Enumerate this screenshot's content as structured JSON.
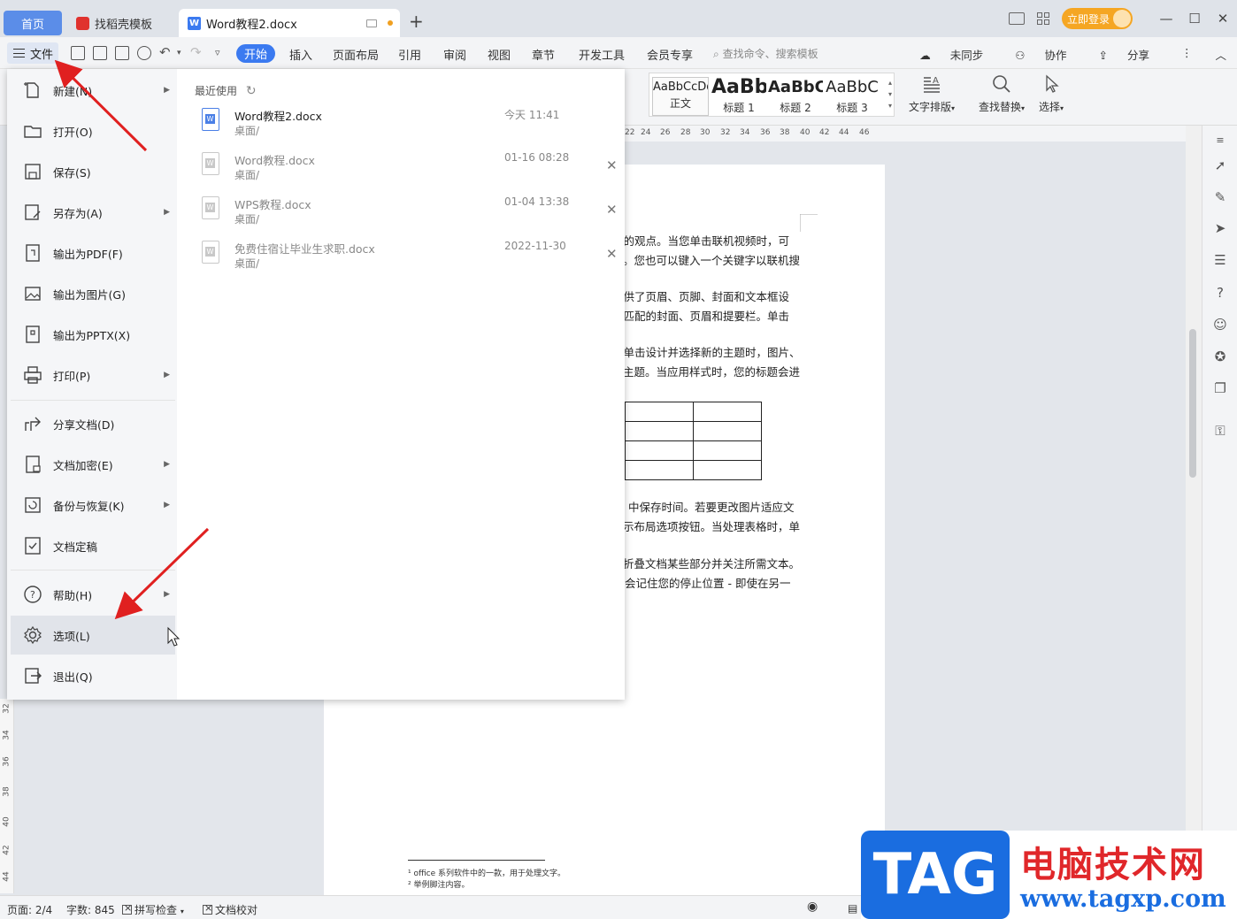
{
  "tabs": {
    "home": "首页",
    "template": "找稻壳模板",
    "document": "Word教程2.docx"
  },
  "window": {
    "login": "立即登录"
  },
  "toolbar": {
    "file": "文件",
    "start": "开始",
    "menus": [
      "插入",
      "页面布局",
      "引用",
      "审阅",
      "视图",
      "章节",
      "开发工具",
      "会员专享"
    ],
    "search_placeholder": "查找命令、搜索模板",
    "unsynced": "未同步",
    "collaborate": "协作",
    "share": "分享"
  },
  "ribbon": {
    "styles": [
      {
        "sample": "AaBbCcDd",
        "name": "正文"
      },
      {
        "sample": "AaBb",
        "name": "标题 1"
      },
      {
        "sample": "AaBbC",
        "name": "标题 2"
      },
      {
        "sample": "AaBbC",
        "name": "标题 3"
      }
    ],
    "text_layout": "文字排版",
    "find_replace": "查找替换",
    "select": "选择"
  },
  "ruler": [
    "22",
    "24",
    "26",
    "28",
    "30",
    "32",
    "34",
    "36",
    "38",
    "40",
    "42",
    "44",
    "46"
  ],
  "vruler": [
    "32",
    "34",
    "36",
    "38",
    "40",
    "42",
    "44"
  ],
  "file_menu": {
    "items": [
      {
        "label": "新建(N)",
        "icon": "new-file-icon",
        "arrow": true
      },
      {
        "label": "打开(O)",
        "icon": "folder-open-icon",
        "arrow": false
      },
      {
        "label": "保存(S)",
        "icon": "save-icon",
        "arrow": false
      },
      {
        "label": "另存为(A)",
        "icon": "save-as-icon",
        "arrow": true
      },
      {
        "label": "输出为PDF(F)",
        "icon": "export-pdf-icon",
        "arrow": false
      },
      {
        "label": "输出为图片(G)",
        "icon": "export-image-icon",
        "arrow": false
      },
      {
        "label": "输出为PPTX(X)",
        "icon": "export-pptx-icon",
        "arrow": false
      },
      {
        "label": "打印(P)",
        "icon": "print-icon",
        "arrow": true
      },
      {
        "label": "分享文档(D)",
        "icon": "share-icon",
        "arrow": false
      },
      {
        "label": "文档加密(E)",
        "icon": "encrypt-icon",
        "arrow": true
      },
      {
        "label": "备份与恢复(K)",
        "icon": "backup-icon",
        "arrow": true
      },
      {
        "label": "文档定稿",
        "icon": "finalize-icon",
        "arrow": false
      },
      {
        "label": "帮助(H)",
        "icon": "help-icon",
        "arrow": true
      },
      {
        "label": "选项(L)",
        "icon": "gear-icon",
        "arrow": false
      },
      {
        "label": "退出(Q)",
        "icon": "exit-icon",
        "arrow": false
      }
    ],
    "recent_title": "最近使用",
    "recent": [
      {
        "name": "Word教程2.docx",
        "path": "桌面/",
        "time": "今天  11:41",
        "active": true
      },
      {
        "name": "Word教程.docx",
        "path": "桌面/",
        "time": "01-16 08:28",
        "active": false
      },
      {
        "name": "WPS教程.docx",
        "path": "桌面/",
        "time": "01-04 13:38",
        "active": false
      },
      {
        "name": "免费住宿让毕业生求职.docx",
        "path": "桌面/",
        "time": "2022-11-30",
        "active": false
      }
    ]
  },
  "document": {
    "lines": [
      "您的观点。当您单击联机视频时，可",
      "。您也可以键入一个关键字以联机搜",
      "提供了页眉、页脚、封面和文本框设",
      "加匹配的封面、页眉和提要栏。单击",
      "您单击设计并选择新的主题时，图片、",
      "主题。当应用样式时，您的标题会进",
      "中保存时间。若要更改图片适应文",
      "示布局选项按钮。当处理表格时，单",
      "折叠文档某些部分并关注所需文本。",
      "会记住您的停止位置 - 即使在另一"
    ],
    "footnotes": [
      "¹ office 系列软件中的一款，用于处理文字。",
      "² 举例脚注内容。"
    ]
  },
  "status": {
    "page": "页面: 2/4",
    "words": "字数: 845",
    "spell": "拼写检查",
    "proof": "文档校对"
  },
  "watermark": {
    "tag": "TAG",
    "site_name": "电脑技术网",
    "url": "www.tagxp.com"
  },
  "colors": {
    "accent": "#3b7af0",
    "arrow": "#e02020",
    "login": "#f5a623"
  }
}
